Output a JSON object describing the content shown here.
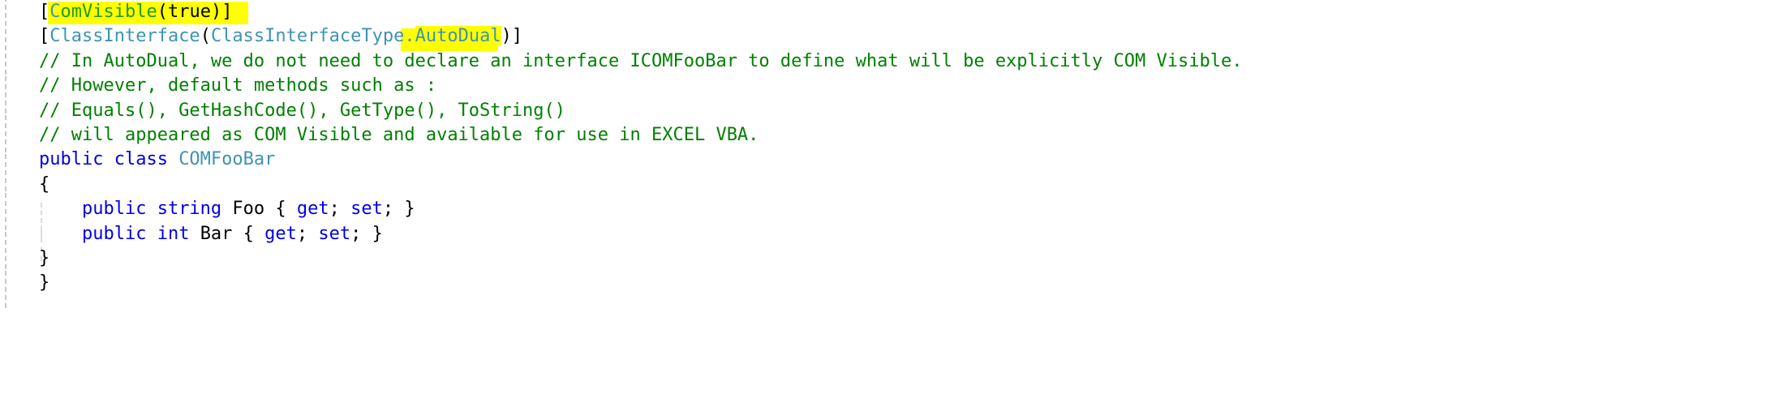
{
  "editor": {
    "language": "csharp",
    "background_color": "#ffffff",
    "highlight_color": "#ffff00",
    "colors": {
      "keyword": "#0000e4",
      "type": "#3f93b3",
      "comment": "#008000",
      "attribute": "#1f9b1f",
      "plain": "#000000"
    }
  },
  "code": {
    "lines": [
      {
        "id": "line-1",
        "indent": 0,
        "tokens": [
          {
            "text": "[",
            "kind": "punct",
            "highlight": false
          },
          {
            "text": "C",
            "kind": "type",
            "highlight": true
          },
          {
            "text": "omVisible",
            "kind": "attribute",
            "highlight": true
          },
          {
            "text": "(true)",
            "kind": "punct",
            "highlight": true
          },
          {
            "text": "]",
            "kind": "punct",
            "highlight": false
          }
        ],
        "plain_text": "[ComVisible(true)]"
      },
      {
        "id": "line-2",
        "indent": 0,
        "tokens": [
          {
            "text": "[",
            "kind": "punct",
            "highlight": false
          },
          {
            "text": "ClassInterface",
            "kind": "type",
            "highlight": false
          },
          {
            "text": "(",
            "kind": "punct",
            "highlight": false
          },
          {
            "text": "ClassInterfaceType",
            "kind": "type",
            "highlight": false
          },
          {
            "text": ".",
            "kind": "type",
            "highlight": false
          },
          {
            "text": "AutoDual",
            "kind": "type",
            "highlight": true
          },
          {
            "text": ")]",
            "kind": "punct",
            "highlight": false
          }
        ],
        "plain_text": "[ClassInterface(ClassInterfaceType.AutoDual)]"
      },
      {
        "id": "line-3",
        "indent": 0,
        "tokens": [
          {
            "text": "// In AutoDual, we do not need to declare an interface ICOMFooBar to define what will be explicitly COM Visible.",
            "kind": "comment",
            "highlight": false
          }
        ],
        "plain_text": "// In AutoDual, we do not need to declare an interface ICOMFooBar to define what will be explicitly COM Visible."
      },
      {
        "id": "line-4",
        "indent": 0,
        "tokens": [
          {
            "text": "// However, default methods such as :",
            "kind": "comment",
            "highlight": false
          }
        ],
        "plain_text": "// However, default methods such as :"
      },
      {
        "id": "line-5",
        "indent": 0,
        "tokens": [
          {
            "text": "// Equals(), GetHashCode(), GetType(), ToString()",
            "kind": "comment",
            "highlight": false
          }
        ],
        "plain_text": "// Equals(), GetHashCode(), GetType(), ToString()"
      },
      {
        "id": "line-6",
        "indent": 0,
        "tokens": [
          {
            "text": "// will appeared as COM Visible and available for use in EXCEL VBA.",
            "kind": "comment",
            "highlight": false
          }
        ],
        "plain_text": "// will appeared as COM Visible and available for use in EXCEL VBA."
      },
      {
        "id": "line-7",
        "indent": 0,
        "tokens": [
          {
            "text": "public class ",
            "kind": "keyword",
            "highlight": false
          },
          {
            "text": "COMFooBar",
            "kind": "type",
            "highlight": false
          }
        ],
        "plain_text": "public class COMFooBar"
      },
      {
        "id": "line-8",
        "indent": 0,
        "tokens": [
          {
            "text": "{",
            "kind": "punct",
            "highlight": false
          }
        ],
        "plain_text": "{"
      },
      {
        "id": "line-9",
        "indent": 1,
        "tokens": [
          {
            "text": "    ",
            "kind": "plain",
            "highlight": false
          },
          {
            "text": "public string ",
            "kind": "keyword",
            "highlight": false
          },
          {
            "text": "Foo { ",
            "kind": "plain",
            "highlight": false
          },
          {
            "text": "get",
            "kind": "keyword",
            "highlight": false
          },
          {
            "text": "; ",
            "kind": "plain",
            "highlight": false
          },
          {
            "text": "set",
            "kind": "keyword",
            "highlight": false
          },
          {
            "text": "; }",
            "kind": "plain",
            "highlight": false
          }
        ],
        "plain_text": "    public string Foo { get; set; }"
      },
      {
        "id": "line-10",
        "indent": 1,
        "tokens": [
          {
            "text": "    ",
            "kind": "plain",
            "highlight": false
          },
          {
            "text": "public int ",
            "kind": "keyword",
            "highlight": false
          },
          {
            "text": "Bar { ",
            "kind": "plain",
            "highlight": false
          },
          {
            "text": "get",
            "kind": "keyword",
            "highlight": false
          },
          {
            "text": "; ",
            "kind": "plain",
            "highlight": false
          },
          {
            "text": "set",
            "kind": "keyword",
            "highlight": false
          },
          {
            "text": "; }",
            "kind": "plain",
            "highlight": false
          }
        ],
        "plain_text": "    public int Bar { get; set; }"
      },
      {
        "id": "line-11",
        "indent": 0,
        "tokens": [
          {
            "text": "}",
            "kind": "punct",
            "highlight": false
          }
        ],
        "plain_text": "}"
      },
      {
        "id": "line-12",
        "indent": 0,
        "tokens": [
          {
            "text": "}",
            "kind": "punct",
            "highlight": false
          }
        ],
        "plain_text": "}"
      }
    ]
  }
}
